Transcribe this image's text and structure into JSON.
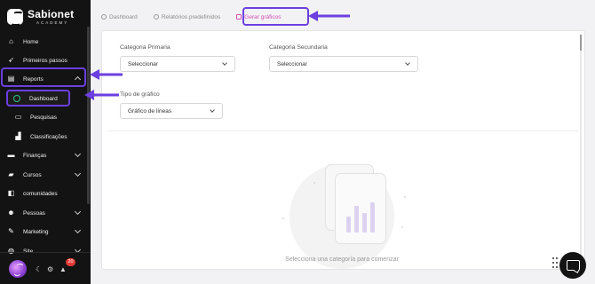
{
  "brand": {
    "name": "Sabionet",
    "subtitle": "ACADEMY"
  },
  "sidebar": {
    "items": [
      {
        "label": "Home",
        "icon": "home-icon"
      },
      {
        "label": "Primeiros passos",
        "icon": "rocket-icon"
      },
      {
        "label": "Reports",
        "icon": "reports-icon",
        "expanded": true
      },
      {
        "label": "Dashboard",
        "icon": "dashboard-icon",
        "active": true
      },
      {
        "label": "Pesquisas",
        "icon": "chat-icon"
      },
      {
        "label": "Classificações",
        "icon": "ranking-icon"
      },
      {
        "label": "Finanças",
        "icon": "finance-icon"
      },
      {
        "label": "Cursos",
        "icon": "courses-icon"
      },
      {
        "label": "comunidades",
        "icon": "community-icon"
      },
      {
        "label": "Pessoas",
        "icon": "people-icon"
      },
      {
        "label": "Marketing",
        "icon": "marketing-icon"
      },
      {
        "label": "Site",
        "icon": "globe-icon"
      }
    ],
    "notifications_count": "20"
  },
  "tabs": [
    {
      "label": "Dashboard",
      "icon": "dashboard-icon"
    },
    {
      "label": "Relatórios predefinidos",
      "icon": "report-icon"
    },
    {
      "label": "Gerar gráficos",
      "icon": "chart-icon",
      "active": true
    }
  ],
  "hidden_tab_fragment": "...",
  "form": {
    "primary": {
      "label": "Categoria Primaria",
      "value": "Seleccionar"
    },
    "secondary": {
      "label": "Categoria Secundaria",
      "value": "Seleccionar"
    },
    "chart_type": {
      "label": "Tipo de gráfico",
      "value": "Gráfico de líneas"
    }
  },
  "empty_state": {
    "message": "Selecciona una categoría para comenzar"
  },
  "colors": {
    "accent": "#6b3fe0",
    "active_tab": "#d44fb3",
    "sidebar_bg": "#131313"
  }
}
